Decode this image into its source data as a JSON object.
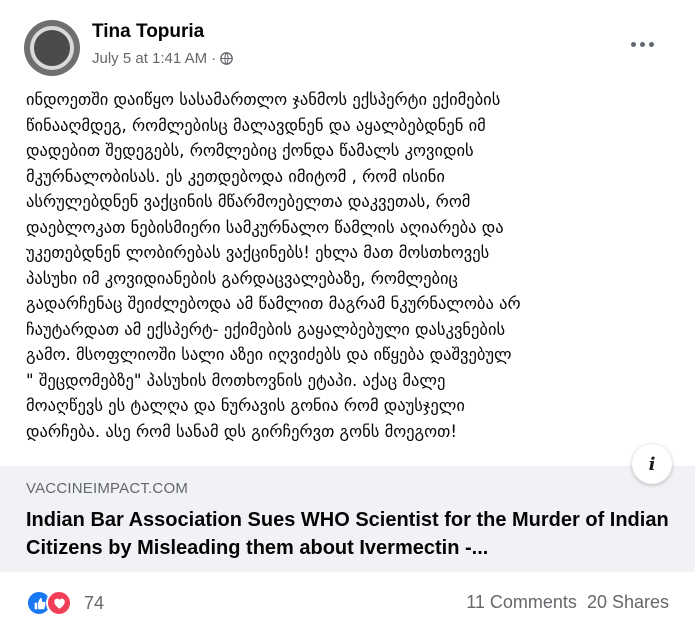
{
  "post": {
    "author": "Tina Topuria",
    "timestamp": "July 5 at 1:41 AM",
    "separator": "·",
    "privacy_icon": "globe-icon",
    "more_icon": "more-options-icon",
    "text": "ინდოეთში დაიწყო სასამართლო ჯანმოს ექსპერტი ექიმების\nწინააღმდეგ, რომლებისც მალავდნენ და აყალბებდნენ იმ\nდადებით შედეგებს, რომლებიც ქონდა წამალს კოვიდის\nმკურნალობისას. ეს კეთდებოდა იმიტომ , რომ ისინი\nასრულებდნენ ვაქცინის მწარმოებელთა დაკვეთას, რომ\nდაებლოკათ ნებისმიერი სამკურნალო წამლის აღიარება  და\nუკეთებდნენ ლობირებას ვაქცინებს! ეხლა მათ მოსთხოვეს\nპასუხი იმ კოვიდიანების გარდაცვალებაზე, რომლებიც\nგადარჩენაც შეიძლებოდა ამ წამლით მაგრამ ნკურნალობა არ\nჩაუტარდათ ამ ექსპერტ- ექიმების გაყალბებული დასკვნების\nგამო. მსოფლიოში სალი აზეი იღვიძებს და იწყება დაშვებულ\n\" შეცდომებზე\" პასუხის მოთხოვნის ეტაპი. აქაც მალე\nმოაღწევს ეს ტალღა და ნურავის გონია რომ დაუსჯელი\nდარჩება. ასე რომ სანამ დს გირჩერვთ  გონს მოეგოთ!"
  },
  "link_preview": {
    "domain": "VACCINEIMPACT.COM",
    "title": "Indian Bar Association Sues WHO Scientist for the Murder of Indian Citizens by Misleading them about Ivermectin -...",
    "info_icon": "info-icon",
    "info_label": "i"
  },
  "footer": {
    "reaction_icons": [
      "like-icon",
      "love-icon"
    ],
    "reaction_count": "74",
    "comments": "11 Comments",
    "shares": "20 Shares"
  },
  "colors": {
    "like": "#1877f2",
    "love": "#f33e58",
    "secondary_text": "#65676b",
    "card_background": "#f0f2f5"
  }
}
